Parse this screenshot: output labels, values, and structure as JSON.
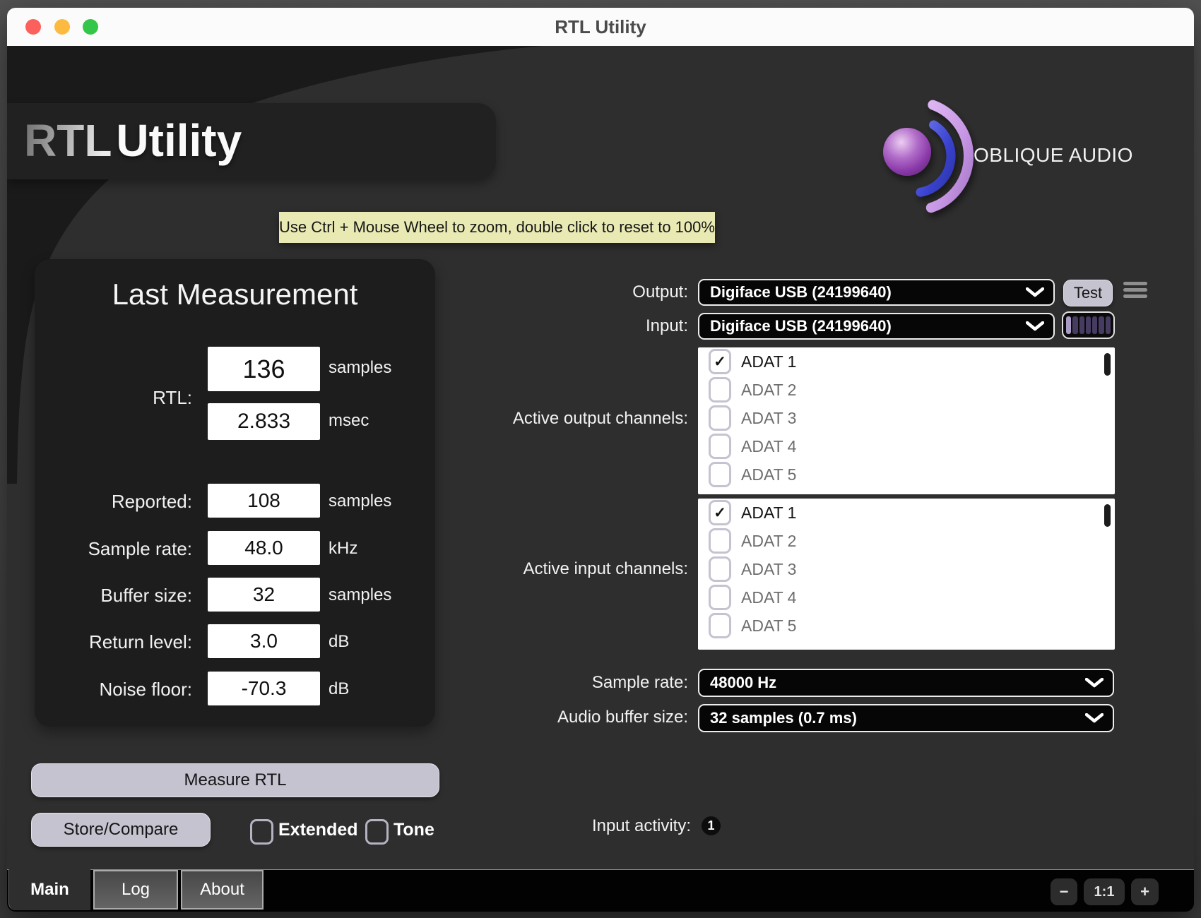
{
  "window": {
    "title": "RTL Utility"
  },
  "header": {
    "logo_primary": "RTL",
    "logo_secondary": "Utility",
    "brand": "OBLIQUE AUDIO"
  },
  "tooltip": {
    "text": "Use Ctrl + Mouse Wheel to zoom, double click to reset to 100%"
  },
  "measurement": {
    "title": "Last Measurement",
    "rtl_label": "RTL:",
    "rtl_samples_value": "136",
    "rtl_samples_unit": "samples",
    "rtl_msec_value": "2.833",
    "rtl_msec_unit": "msec",
    "rows": [
      {
        "label": "Reported:",
        "value": "108",
        "unit": "samples"
      },
      {
        "label": "Sample rate:",
        "value": "48.0",
        "unit": "kHz"
      },
      {
        "label": "Buffer size:",
        "value": "32",
        "unit": "samples"
      },
      {
        "label": "Return level:",
        "value": "3.0",
        "unit": "dB"
      },
      {
        "label": "Noise floor:",
        "value": "-70.3",
        "unit": "dB"
      }
    ]
  },
  "actions": {
    "measure": "Measure RTL",
    "store_compare": "Store/Compare",
    "extended_label": "Extended",
    "extended_checked": false,
    "tone_label": "Tone",
    "tone_checked": false
  },
  "activity": {
    "label": "Input activity:",
    "count": "1"
  },
  "device": {
    "output_label": "Output:",
    "output_value": "Digiface USB (24199640)",
    "test_button": "Test",
    "input_label": "Input:",
    "input_value": "Digiface USB (24199640)",
    "meter_levels": [
      1,
      0,
      0,
      0,
      0,
      0,
      0
    ],
    "output_channels_label": "Active output channels:",
    "output_channels": [
      {
        "label": "ADAT 1",
        "checked": true
      },
      {
        "label": "ADAT 2",
        "checked": false
      },
      {
        "label": "ADAT 3",
        "checked": false
      },
      {
        "label": "ADAT 4",
        "checked": false
      },
      {
        "label": "ADAT 5",
        "checked": false
      }
    ],
    "input_channels_label": "Active input channels:",
    "input_channels": [
      {
        "label": "ADAT 1",
        "checked": true
      },
      {
        "label": "ADAT 2",
        "checked": false
      },
      {
        "label": "ADAT 3",
        "checked": false
      },
      {
        "label": "ADAT 4",
        "checked": false
      },
      {
        "label": "ADAT 5",
        "checked": false
      }
    ],
    "sample_rate_label": "Sample rate:",
    "sample_rate_value": "48000 Hz",
    "buffer_label": "Audio buffer size:",
    "buffer_value": "32 samples (0.7 ms)"
  },
  "tabs": [
    {
      "label": "Main",
      "active": true
    },
    {
      "label": "Log",
      "active": false
    },
    {
      "label": "About",
      "active": false
    }
  ],
  "zoom_controls": {
    "out": "−",
    "reset": "1:1",
    "in": "+"
  },
  "colors": {
    "accent_button": "#c5c3d0",
    "tooltip_bg": "#e9e9b4",
    "meter_active": "#a89cc6",
    "meter_inactive": "#463b60",
    "brand_purple": "#a44fc0"
  }
}
